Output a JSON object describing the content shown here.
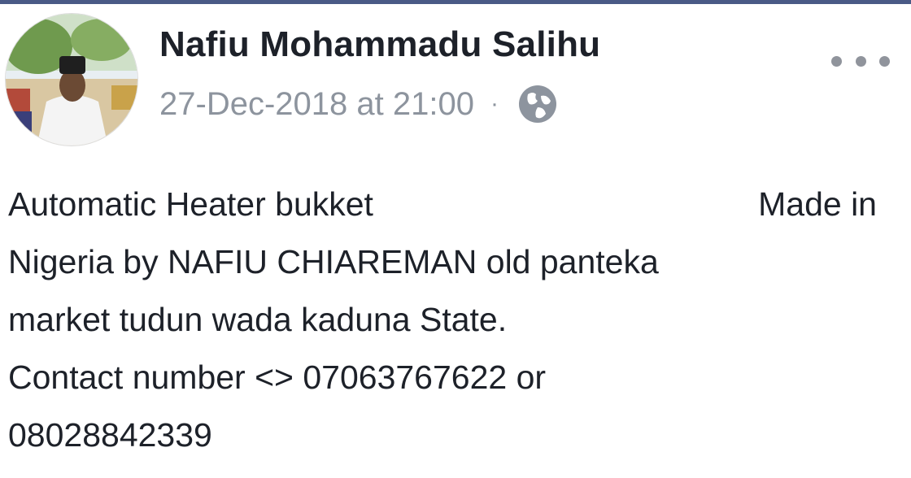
{
  "post": {
    "author": "Nafiu Mohammadu Salihu",
    "timestamp": "27-Dec-2018 at 21:00",
    "separator": "·",
    "privacy_icon": "globe-icon",
    "more_icon": "more-options-icon",
    "body": {
      "line1_left": "Automatic Heater bukket",
      "line1_right": "Made in",
      "line2": "Nigeria by NAFIU CHIAREMAN old panteka",
      "line3": "market tudun wada kaduna State.",
      "line4": "Contact number <> 07063767622 or",
      "line5": "08028842339"
    }
  },
  "colors": {
    "accent_bar": "#4a5a86",
    "name_text": "#1d2129",
    "meta_text": "#8d949e"
  }
}
